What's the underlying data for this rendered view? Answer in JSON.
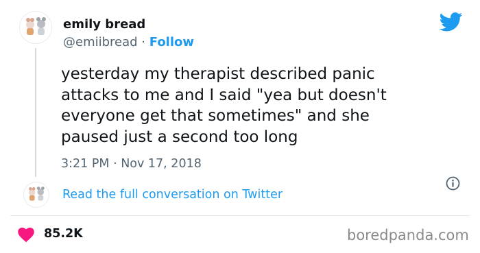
{
  "tweet": {
    "author_name": "emily bread",
    "handle": "@emiibread",
    "separator": " · ",
    "follow_label": "Follow",
    "text": "yesterday my therapist described panic\nattacks to me and I said \"yea but doesn't\neveryone get that sometimes\" and she\npaused just a second too long",
    "timestamp": "3:21 PM · Nov 17, 2018",
    "read_link": "Read the full conversation on Twitter",
    "likes": "85.2K"
  },
  "watermark": "boredpanda.com",
  "icons": {
    "brand": "twitter-bird-icon",
    "info": "info-icon",
    "like": "heart-icon",
    "avatar": "cat-avatar"
  },
  "colors": {
    "twitter_blue": "#1d9bf0",
    "heart": "#f91880",
    "text": "#0f1419",
    "muted": "#536471"
  }
}
